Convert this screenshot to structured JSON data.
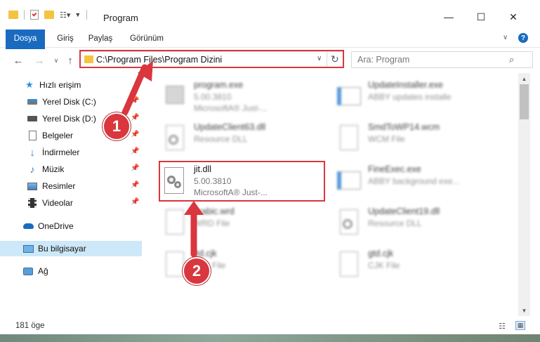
{
  "window": {
    "title": "Program",
    "controls": {
      "minimize": "—",
      "maximize": "☐",
      "close": "✕"
    }
  },
  "ribbon": {
    "tabs": [
      {
        "label": "Dosya"
      },
      {
        "label": "Giriş"
      },
      {
        "label": "Paylaş"
      },
      {
        "label": "Görünüm"
      }
    ]
  },
  "address": {
    "path": "C:\\Program Files\\Program Dizini",
    "search_placeholder": "Ara: Program"
  },
  "nav": {
    "items": [
      {
        "label": "Hızlı erişim",
        "icon": "star-icon",
        "pinned": false
      },
      {
        "label": "Yerel Disk (C:)",
        "icon": "drive-icon",
        "pinned": true
      },
      {
        "label": "Yerel Disk (D:)",
        "icon": "drive-icon",
        "pinned": true
      },
      {
        "label": "Belgeler",
        "icon": "documents-icon",
        "pinned": true
      },
      {
        "label": "İndirmeler",
        "icon": "download-icon",
        "pinned": true
      },
      {
        "label": "Müzik",
        "icon": "music-icon",
        "pinned": true
      },
      {
        "label": "Resimler",
        "icon": "pictures-icon",
        "pinned": true
      },
      {
        "label": "Videolar",
        "icon": "videos-icon",
        "pinned": true
      },
      {
        "label": "OneDrive",
        "icon": "cloud-icon",
        "pinned": false
      },
      {
        "label": "Bu bilgisayar",
        "icon": "computer-icon",
        "pinned": false,
        "selected": true
      },
      {
        "label": "Ağ",
        "icon": "network-icon",
        "pinned": false
      }
    ]
  },
  "files": [
    {
      "name": "program.exe",
      "line2": "5.00.3810",
      "line3": "MicrosoftA® Just-...",
      "icon": "app-icon",
      "blurred": true
    },
    {
      "name": "UpdateInstaller.exe",
      "line2": "ABBY updates installe",
      "line3": "",
      "icon": "window-icon",
      "blurred": true
    },
    {
      "name": "UpdateClient63.dll",
      "line2": "Resource DLL",
      "line3": "",
      "icon": "dll-icon",
      "blurred": true
    },
    {
      "name": "SmdToWP14.wcm",
      "line2": "WCM File",
      "line3": "",
      "icon": "blank-file-icon",
      "blurred": true
    },
    {
      "name": "jit.dll",
      "line2": "5.00.3810",
      "line3": "MicrosoftA® Just-...",
      "icon": "dll-icon",
      "blurred": false
    },
    {
      "name": "FineExec.exe",
      "line2": "ABBY background exe...",
      "line3": "",
      "icon": "window-icon",
      "blurred": true
    },
    {
      "name": "arabic.wrd",
      "line2": "WRD File",
      "line3": "",
      "icon": "blank-file-icon",
      "blurred": true
    },
    {
      "name": "UpdateClient19.dll",
      "line2": "Resource DLL",
      "line3": "",
      "icon": "dll-icon",
      "blurred": true
    },
    {
      "name": "ttd.cjk",
      "line2": "CJK File",
      "line3": "",
      "icon": "blank-file-icon",
      "blurred": true
    },
    {
      "name": "gtd.cjk",
      "line2": "CJK File",
      "line3": "",
      "icon": "blank-file-icon",
      "blurred": true
    }
  ],
  "callouts": {
    "one": "1",
    "two": "2"
  },
  "status": {
    "count": "181 öge"
  },
  "colors": {
    "accent": "#1a6bbf",
    "highlight": "#d9363e",
    "selected": "#cde8f8"
  }
}
